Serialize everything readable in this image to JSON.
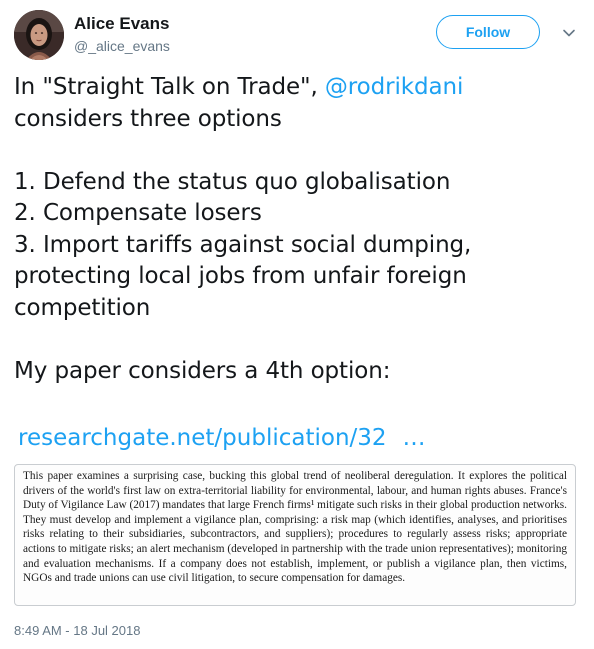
{
  "author": {
    "name": "Alice Evans",
    "handle": "@_alice_evans"
  },
  "follow_button": {
    "label": "Follow"
  },
  "tweet": {
    "intro_before_mention": "In \"Straight Talk on Trade\", ",
    "mention": "@rodrikdani",
    "intro_after_mention": "considers three options",
    "options": [
      "1. Defend the status quo globalisation",
      "2. Compensate losers",
      "3. Import tariffs against social dumping, protecting local jobs from unfair foreign competition"
    ],
    "closing": "My paper considers a 4th option:",
    "link_text": "researchgate.net/publication/32",
    "link_ellipsis": "…"
  },
  "attached_image": {
    "text": "This paper examines a surprising case, bucking this global trend of neoliberal deregulation. It explores the political drivers of the world's first law on extra-territorial liability for environmental, labour, and human rights abuses. France's Duty of Vigilance Law (2017) mandates that large French firms¹ mitigate such risks in their global production networks. They must develop and implement a vigilance plan, comprising: a risk map (which identifies, analyses, and prioritises risks relating to their subsidiaries, subcontractors, and suppliers); procedures to regularly assess risks; appropriate actions to mitigate risks; an alert mechanism (developed in partnership with the trade union representatives); monitoring and evaluation mechanisms. If a company does not establish, implement, or publish a vigilance plan, then victims, NGOs and trade unions can use civil litigation, to secure compensation for damages."
  },
  "timestamp": "8:49 AM - 18 Jul 2018",
  "icons": {
    "avatar": "profile-photo",
    "caret": "chevron-down-icon"
  },
  "colors": {
    "accent": "#1da1f2",
    "text": "#14171a",
    "secondary": "#657786"
  }
}
